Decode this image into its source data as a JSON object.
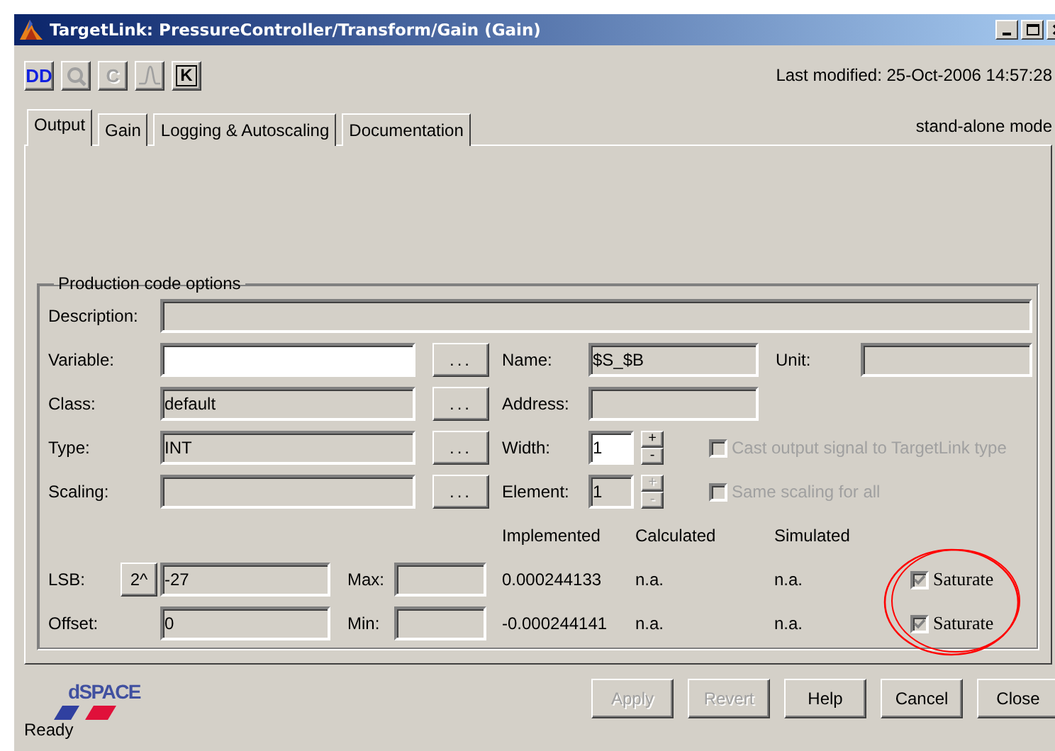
{
  "window": {
    "title": "TargetLink: PressureController/Transform/Gain  (Gain)"
  },
  "toolbar": [
    {
      "kind": "text",
      "label": "DD",
      "disabled": false
    },
    {
      "kind": "magnifier",
      "disabled": true
    },
    {
      "kind": "text",
      "label": "C",
      "disabled": true
    },
    {
      "kind": "curve",
      "disabled": true
    },
    {
      "kind": "boxed",
      "label": "K",
      "disabled": false
    }
  ],
  "last_modified": "Last modified: 25-Oct-2006 14:57:28",
  "tabs": [
    {
      "label": "Output",
      "selected": true
    },
    {
      "label": "Gain",
      "selected": false
    },
    {
      "label": "Logging & Autoscaling",
      "selected": false
    },
    {
      "label": "Documentation",
      "selected": false
    }
  ],
  "mode": "stand-alone mode",
  "group": {
    "title": "Production code options",
    "description": {
      "label": "Description:",
      "disabled": true
    },
    "variable": {
      "label": "Variable:",
      "disabled": false,
      "browse": "..."
    },
    "name": {
      "label": "Name:",
      "value": "$S_$B",
      "disabled": true
    },
    "unit": {
      "label": "Unit:",
      "disabled": true
    },
    "class": {
      "label": "Class:",
      "value": "default",
      "disabled": true,
      "browse": "..."
    },
    "address": {
      "label": "Address:",
      "disabled": true
    },
    "type": {
      "label": "Type:",
      "value": "INT",
      "disabled": true,
      "browse": "..."
    },
    "width": {
      "label": "Width:",
      "value": "1",
      "disabled": false,
      "plus": "+",
      "minus": "-"
    },
    "cast": {
      "label": "Cast output signal to TargetLink type",
      "checked": false,
      "disabled": true
    },
    "scaling": {
      "label": "Scaling:",
      "disabled": true,
      "browse": "..."
    },
    "element": {
      "label": "Element:",
      "value": "1",
      "disabled": true,
      "plus": "+",
      "minus": "-"
    },
    "same_scaling": {
      "label": "Same scaling for all",
      "checked": false,
      "disabled": true
    },
    "columns": [
      "Implemented",
      "Calculated",
      "Simulated"
    ],
    "lsb": {
      "label": "LSB:",
      "base_button": "2^",
      "value": "-27",
      "disabled": true,
      "limit_label": "Max:",
      "limit_disabled": true,
      "implemented": "0.000244133",
      "calculated": "n.a.",
      "simulated": "n.a.",
      "saturate": {
        "label": "Saturate",
        "checked": true,
        "disabled": true
      }
    },
    "offset": {
      "label": "Offset:",
      "value": "0",
      "disabled": true,
      "limit_label": "Min:",
      "limit_disabled": true,
      "implemented": "-0.000244141",
      "calculated": "n.a.",
      "simulated": "n.a.",
      "saturate": {
        "label": "Saturate",
        "checked": true,
        "disabled": true
      }
    }
  },
  "buttons": [
    {
      "label": "Apply",
      "disabled": true
    },
    {
      "label": "Revert",
      "disabled": true
    },
    {
      "label": "Help",
      "disabled": false
    },
    {
      "label": "Cancel",
      "disabled": false
    },
    {
      "label": "Close",
      "disabled": false
    }
  ],
  "logo": "dSPACE",
  "status": "Ready"
}
